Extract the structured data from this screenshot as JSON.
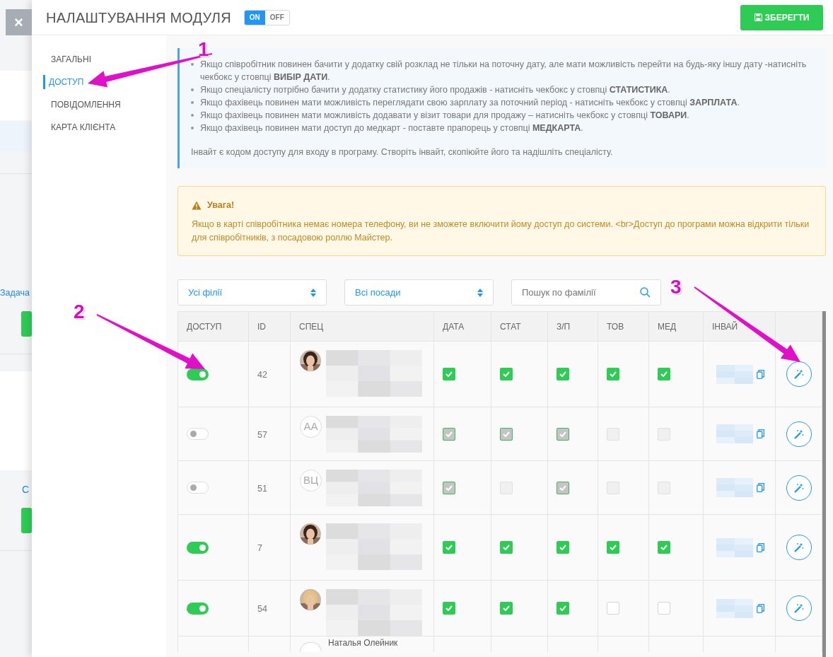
{
  "background_page": {
    "close_button": "×",
    "link_1": "Задача",
    "link_2": "С"
  },
  "header": {
    "title": "НАЛАШТУВАННЯ МОДУЛЯ",
    "module_switch": [
      {
        "label": "ON",
        "selected": true
      },
      {
        "label": "OFF",
        "selected": false
      }
    ],
    "save_button": "ЗБЕРЕГТИ"
  },
  "sidebar": {
    "items": [
      {
        "label": "ЗАГАЛЬНІ",
        "selected": false
      },
      {
        "label": "ДОСТУП",
        "selected": true
      },
      {
        "label": "ПОВІДОМЛЕННЯ",
        "selected": false
      },
      {
        "label": "КАРТА КЛІЄНТА",
        "selected": false
      }
    ]
  },
  "info_box": {
    "items": [
      "Якщо співробітник повинен бачити у додатку свій розклад не тільки на поточну дату, але мати можливість перейти на будь-яку іншу дату -натисніть чекбокс у стовпці **ВИБІР ДАТИ**.",
      "Якщо спеціалісту потрібно бачити у додатку статистику його продажів - натисніть чекбокс у стовпці **СТАТИСТИКА**.",
      "Якщо фахівець повинен мати можливість переглядати свою зарплату за поточний період - натисніть чекбокс у стовпці **ЗАРПЛАТА**.",
      "Якщо фахівець повинен мати можливість додавати у візит товари для продажу – натисніть чекбокс у стовпці **ТОВАРИ**.",
      "Якщо фахівець повинен мати доступ до медкарт - поставте прапорець у стовпці **МЕДКАРТА**."
    ],
    "note": "Інвайт є кодом доступу для входу в програму. Створіть інвайт, скопіюйте його та надішліть спеціалісту."
  },
  "warning": {
    "title": "Увага!",
    "text": "Якщо в карті співробітника немає номера телефону, ви не зможете включити йому доступ до системи. <br>Доступ до програми можна відкрити тільки для співробітників, з посадовою роллю Майстер."
  },
  "filters": {
    "branch": "Усі філії",
    "position": "Всі посади",
    "search": {
      "placeholder": "Пошук по фамілії"
    }
  },
  "table": {
    "columns": [
      "ДОСТУП",
      "ID",
      "СПЕЦ",
      "ДАТА",
      "СТАТ",
      "З/П",
      "ТОВ",
      "МЕД",
      "ІНВАЙ"
    ],
    "rows": [
      {
        "access": true,
        "id": "42",
        "checks": [
          {
            "checked": true,
            "disabled": false
          },
          {
            "checked": true,
            "disabled": false
          },
          {
            "checked": true,
            "disabled": false
          },
          {
            "checked": true,
            "disabled": false
          },
          {
            "checked": true,
            "disabled": false
          }
        ]
      },
      {
        "access": false,
        "id": "57",
        "avatar": {
          "kind": "initials",
          "text": "АА"
        },
        "checks": [
          {
            "checked": true,
            "disabled": true
          },
          {
            "checked": true,
            "disabled": true
          },
          {
            "checked": true,
            "disabled": true
          },
          {
            "checked": false,
            "disabled": true
          },
          {
            "checked": false,
            "disabled": true
          }
        ]
      },
      {
        "access": false,
        "id": "51",
        "avatar": {
          "kind": "initials",
          "text": "ВЦ"
        },
        "checks": [
          {
            "checked": true,
            "disabled": true
          },
          {
            "checked": false,
            "disabled": true
          },
          {
            "checked": true,
            "disabled": true
          },
          {
            "checked": false,
            "disabled": true
          },
          {
            "checked": false,
            "disabled": true
          }
        ]
      },
      {
        "access": true,
        "id": "7",
        "checks": [
          {
            "checked": true,
            "disabled": false
          },
          {
            "checked": true,
            "disabled": false
          },
          {
            "checked": true,
            "disabled": false
          },
          {
            "checked": true,
            "disabled": false
          },
          {
            "checked": true,
            "disabled": false
          }
        ]
      },
      {
        "access": true,
        "id": "54",
        "checks": [
          {
            "checked": true,
            "disabled": false
          },
          {
            "checked": true,
            "disabled": false
          },
          {
            "checked": true,
            "disabled": false
          },
          {
            "checked": false,
            "disabled": false
          },
          {
            "checked": false,
            "disabled": false
          }
        ]
      }
    ],
    "partial_row": {
      "name": "Наталья Олейник"
    }
  },
  "annotations": [
    {
      "label": "1"
    },
    {
      "label": "2"
    },
    {
      "label": "3"
    }
  ]
}
